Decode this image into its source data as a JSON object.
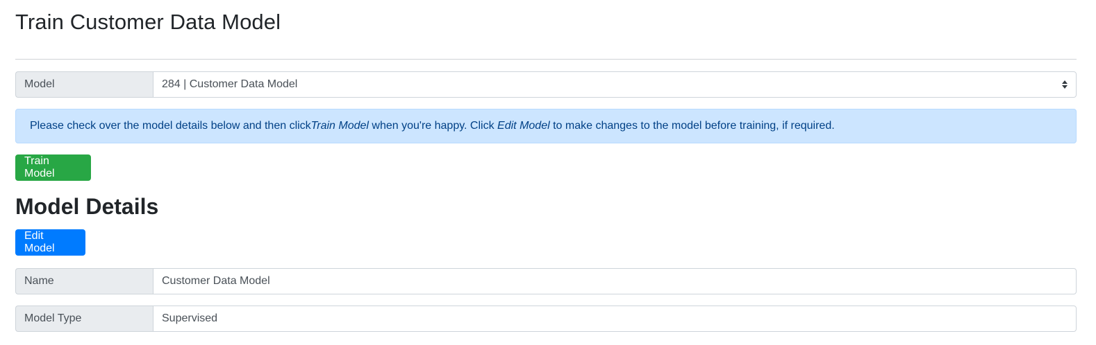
{
  "header": {
    "title": "Train Customer Data Model"
  },
  "model_select": {
    "label": "Model",
    "value": "284 | Customer Data Model"
  },
  "alert": {
    "text_1": "Please check over the model details below and then click ",
    "emph_1": "Train Model",
    "text_2": " when you're happy. Click ",
    "emph_2": "Edit Model",
    "text_3": " to make changes to the model before training, if required."
  },
  "actions": {
    "train_label": "Train Model",
    "edit_label": "Edit Model"
  },
  "details": {
    "title": "Model Details",
    "fields": [
      {
        "label": "Name",
        "value": "Customer Data Model"
      },
      {
        "label": "Model Type",
        "value": "Supervised"
      }
    ]
  },
  "colors": {
    "success": "#28a745",
    "primary": "#007bff",
    "info_bg": "#cce5ff",
    "info_text": "#004085"
  },
  "icons": {
    "select_arrow": "sort-updown-icon"
  }
}
